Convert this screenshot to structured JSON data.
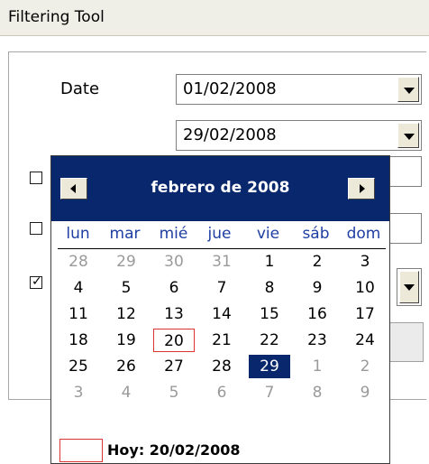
{
  "header": {
    "title": "Filtering Tool"
  },
  "form": {
    "date_label": "Date",
    "date_from": "01/02/2008",
    "date_to": "29/02/2008",
    "checkbox_3_checked": true
  },
  "calendar": {
    "month_title": "febrero de 2008",
    "weekdays": [
      "lun",
      "mar",
      "mié",
      "jue",
      "vie",
      "sáb",
      "dom"
    ],
    "weeks": [
      [
        "28",
        "29",
        "30",
        "31",
        "1",
        "2",
        "3"
      ],
      [
        "4",
        "5",
        "6",
        "7",
        "8",
        "9",
        "10"
      ],
      [
        "11",
        "12",
        "13",
        "14",
        "15",
        "16",
        "17"
      ],
      [
        "18",
        "19",
        "20",
        "21",
        "22",
        "23",
        "24"
      ],
      [
        "25",
        "26",
        "27",
        "28",
        "29",
        "1",
        "2"
      ],
      [
        "3",
        "4",
        "5",
        "6",
        "7",
        "8",
        "9"
      ]
    ],
    "today_day": "20",
    "selected_day": "29",
    "today_label": "Hoy: 20/02/2008",
    "colors": {
      "header_bg": "#08276d",
      "weekday_text": "#1e3ea3",
      "today_border": "#dd3333",
      "other_month_text": "#9a9a9a"
    }
  }
}
